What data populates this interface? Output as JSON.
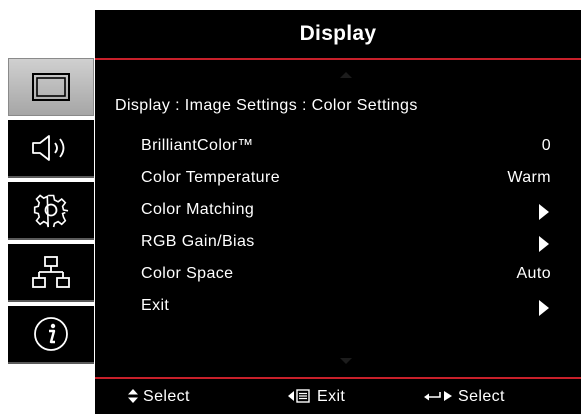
{
  "header": {
    "title": "Display"
  },
  "sidebar": {
    "items": [
      {
        "name": "display",
        "icon": "display-icon",
        "active": true
      },
      {
        "name": "audio",
        "icon": "speaker-icon",
        "active": false
      },
      {
        "name": "setup",
        "icon": "gear-icon",
        "active": false
      },
      {
        "name": "network",
        "icon": "network-icon",
        "active": false
      },
      {
        "name": "info",
        "icon": "info-icon",
        "active": false
      }
    ]
  },
  "main": {
    "breadcrumb": "Display : Image Settings : Color Settings",
    "items": [
      {
        "label": "BrilliantColor™",
        "value": "0",
        "type": "value"
      },
      {
        "label": "Color Temperature",
        "value": "Warm",
        "type": "value"
      },
      {
        "label": "Color Matching",
        "type": "submenu"
      },
      {
        "label": "RGB Gain/Bias",
        "type": "submenu"
      },
      {
        "label": "Color Space",
        "value": "Auto",
        "type": "value"
      },
      {
        "label": "Exit",
        "type": "submenu"
      }
    ]
  },
  "footer": {
    "select_label": "Select",
    "exit_label": "Exit",
    "enter_label": "Select",
    "select_glyph": "▲▼",
    "exit_glyph": "◀▤",
    "enter_glyph": "↵▶"
  },
  "colors": {
    "background": "#000000",
    "text": "#ffffff",
    "accent_rule": "#c8202a",
    "active_tab": "#bdbdbd"
  }
}
